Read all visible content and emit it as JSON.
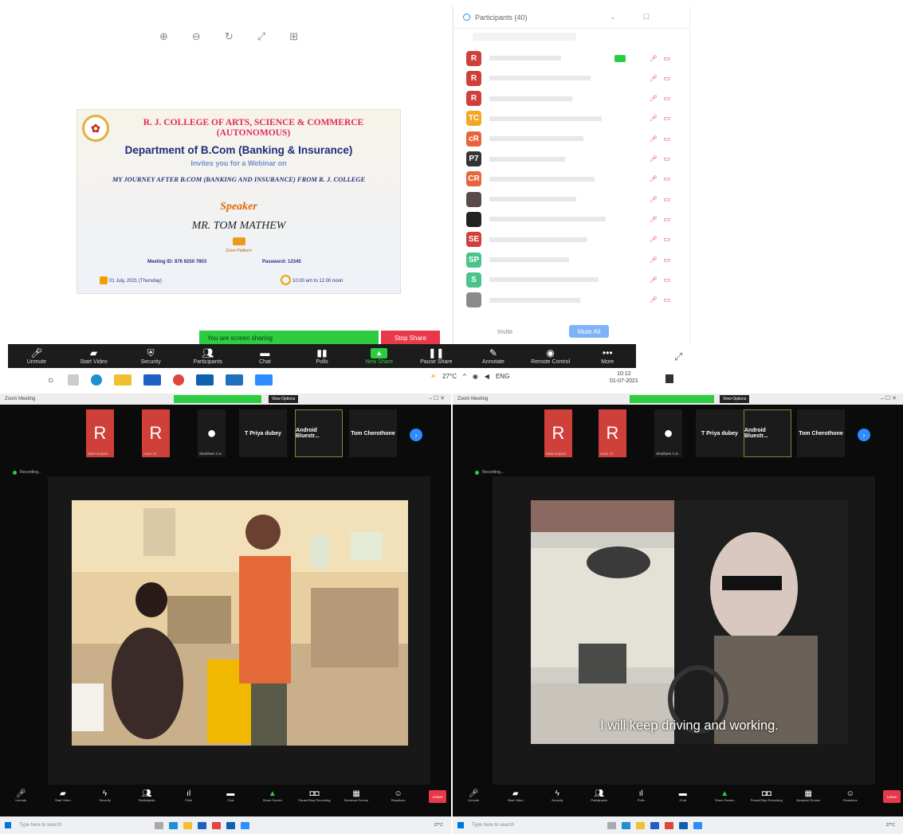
{
  "top_toolbar_icons": [
    "zoom-in-icon",
    "zoom-out-icon",
    "rotate-icon",
    "fit-icon",
    "grid-icon"
  ],
  "flyer": {
    "college": "R. J. COLLEGE OF ARTS, SCIENCE & COMMERCE (AUTONOMOUS)",
    "department": "Department of B.Com (Banking & Insurance)",
    "invite": "Invites you for a Webinar on",
    "topic": "MY JOURNEY AFTER B.COM (BANKING AND INSURANCE) FROM R. J. COLLEGE",
    "speaker_label": "Speaker",
    "speaker_name": "MR. TOM MATHEW",
    "platform": "Zoom Platform",
    "meeting_id": "Meeting ID: 876 9250 7803",
    "password": "Password: 12345",
    "date": "01 July, 2021 (Thursday)",
    "time": "10.00 am to 12.00 noon"
  },
  "participants_panel": {
    "title": "Participants (40)",
    "invite_label": "Invite",
    "mute_all_label": "Mute All",
    "rows": [
      {
        "initials": "R",
        "color": "#d0403a"
      },
      {
        "initials": "R",
        "color": "#d0403a"
      },
      {
        "initials": "R",
        "color": "#d0403a"
      },
      {
        "initials": "TC",
        "color": "#f5a623"
      },
      {
        "initials": "cR",
        "color": "#e8643a"
      },
      {
        "initials": "P7",
        "color": "#333333"
      },
      {
        "initials": "CR",
        "color": "#e8643a"
      },
      {
        "initials": "",
        "color": "#5a4a4a"
      },
      {
        "initials": "",
        "color": "#222222"
      },
      {
        "initials": "SE",
        "color": "#d0403a"
      },
      {
        "initials": "SP",
        "color": "#4cc38a"
      },
      {
        "initials": "S",
        "color": "#4cc38a"
      },
      {
        "initials": "",
        "color": "#8a8a8a"
      }
    ]
  },
  "share_banner": {
    "text": "You are screen sharing",
    "stop_label": "Stop Share"
  },
  "zoom_toolbar": [
    {
      "icon": "mic-muted-icon",
      "label": "Unmute"
    },
    {
      "icon": "video-off-icon",
      "label": "Start Video"
    },
    {
      "icon": "shield-icon",
      "label": "Security"
    },
    {
      "icon": "participants-icon",
      "label": "Participants"
    },
    {
      "icon": "chat-icon",
      "label": "Chat"
    },
    {
      "icon": "polls-icon",
      "label": "Polls"
    },
    {
      "icon": "new-share-icon",
      "label": "New Share"
    },
    {
      "icon": "pause-icon",
      "label": "Pause Share"
    },
    {
      "icon": "annotate-icon",
      "label": "Annotate"
    },
    {
      "icon": "remote-control-icon",
      "label": "Remote Control"
    },
    {
      "icon": "more-icon",
      "label": "More"
    }
  ],
  "tray": {
    "temp": "27°C",
    "lang": "ENG",
    "time": "10:12",
    "date": "01-07-2021"
  },
  "left_window": {
    "title": "Zoom Meeting",
    "view_options": "View Options",
    "tiles": [
      {
        "type": "letter",
        "text": "R",
        "caption": "Mate Dopian"
      },
      {
        "type": "letter",
        "text": "R",
        "caption": "roam 41"
      },
      {
        "type": "person",
        "caption": "Shubham C.K."
      },
      {
        "type": "text",
        "text": "T Priya dubey"
      },
      {
        "type": "text",
        "text": "Android Bluestr..."
      },
      {
        "type": "text",
        "text": "Tom Cherothone"
      }
    ],
    "recording": "Recording..."
  },
  "right_window": {
    "title": "Zoom Meeting",
    "view_options": "View Options",
    "tiles": [
      {
        "type": "letter",
        "text": "R",
        "caption": "Mate Dopian"
      },
      {
        "type": "letter",
        "text": "R",
        "caption": "roam 41"
      },
      {
        "type": "person",
        "caption": "Shubham C.K."
      },
      {
        "type": "text",
        "text": "T Priya dubey"
      },
      {
        "type": "text",
        "text": "Android Bluestr..."
      },
      {
        "type": "text",
        "text": "Tom Cherothone"
      }
    ],
    "recording": "Recording...",
    "caption": "I will keep driving and working."
  },
  "window_toolbar": [
    {
      "icon": "mic-muted-icon",
      "label": "Unmute"
    },
    {
      "icon": "video-off-icon",
      "label": "Start Video"
    },
    {
      "icon": "shield-icon",
      "label": "Security"
    },
    {
      "icon": "participants-icon",
      "label": "Participants"
    },
    {
      "icon": "polls-icon",
      "label": "Polls"
    },
    {
      "icon": "chat-icon",
      "label": "Chat"
    },
    {
      "icon": "share-screen-icon",
      "label": "Share Screen"
    },
    {
      "icon": "record-icon",
      "label": "Pause/Stop Recording"
    },
    {
      "icon": "breakout-icon",
      "label": "Breakout Rooms"
    },
    {
      "icon": "reactions-icon",
      "label": "Reactions"
    }
  ],
  "leave_label": "Leave",
  "search_placeholder": "Type here to search",
  "colors": {
    "zoom_blue": "#2d8cff",
    "share_green": "#2ecc40",
    "stop_red": "#e8394a"
  }
}
